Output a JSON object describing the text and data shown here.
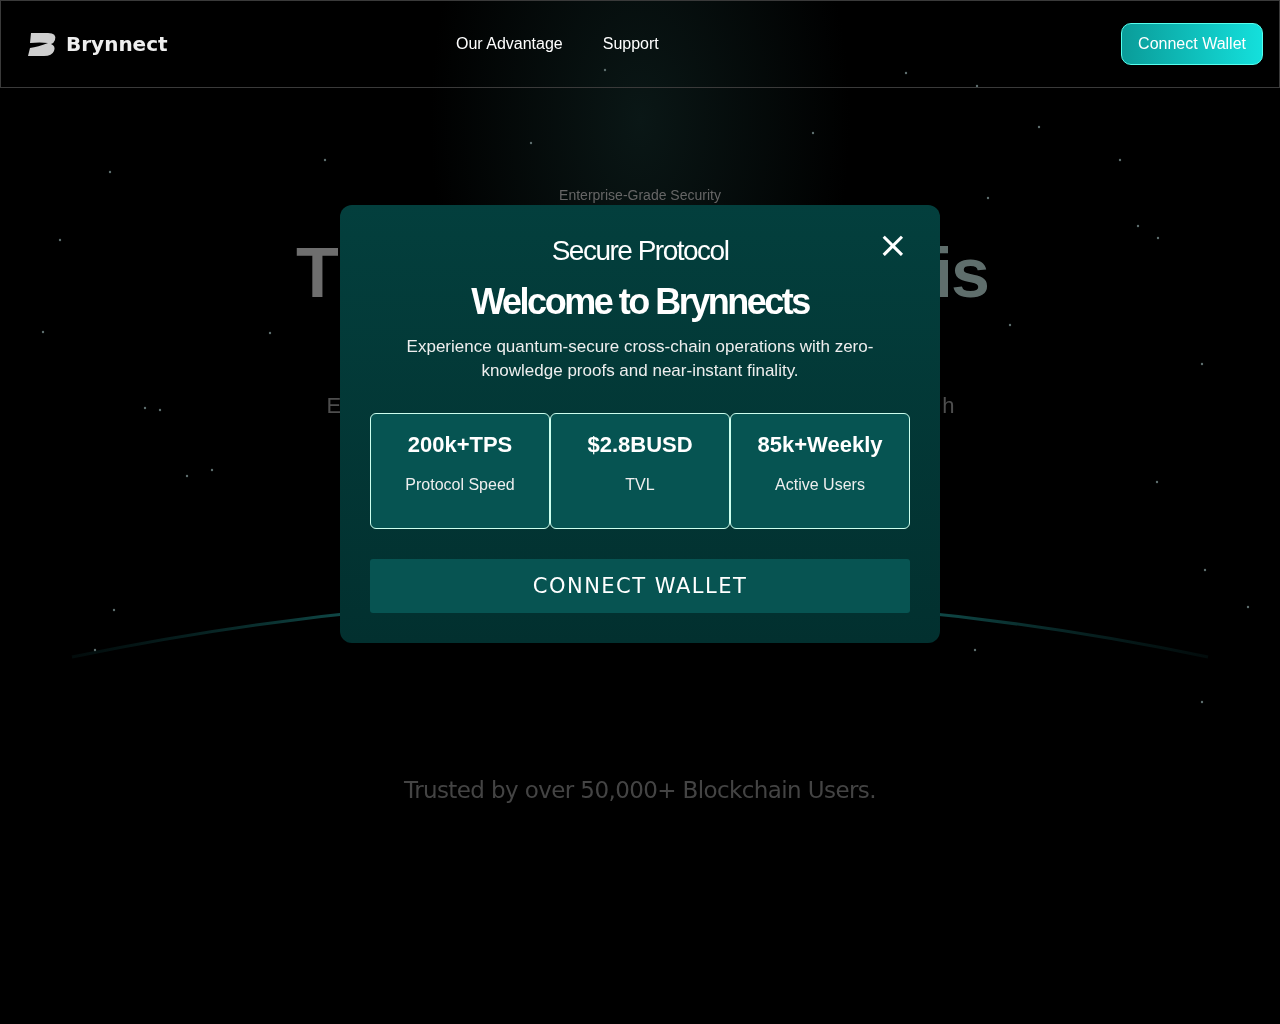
{
  "header": {
    "brand": "Brynnect",
    "nav": [
      {
        "label": "Our Advantage"
      },
      {
        "label": "Support"
      }
    ],
    "cta": "Connect Wallet"
  },
  "hero": {
    "eyebrow": "Enterprise-Grade Security",
    "heading_left": "T",
    "heading_right": "is",
    "subtitle_left": "E",
    "subtitle_right": "h",
    "trust": "Trusted by over 50,000+ Blockchain Users."
  },
  "modal": {
    "kicker": "Secure Protocol",
    "title": "Welcome to Brynnects",
    "body": "Experience quantum-secure cross-chain operations with zero-knowledge proofs and near-instant finality.",
    "close": "×",
    "stats": [
      {
        "value": "200k+TPS",
        "label": "Protocol Speed"
      },
      {
        "value": "$2.8BUSD",
        "label": "TVL"
      },
      {
        "value": "85k+Weekly",
        "label": "Active Users"
      }
    ],
    "button": "CONNECT WALLET"
  }
}
